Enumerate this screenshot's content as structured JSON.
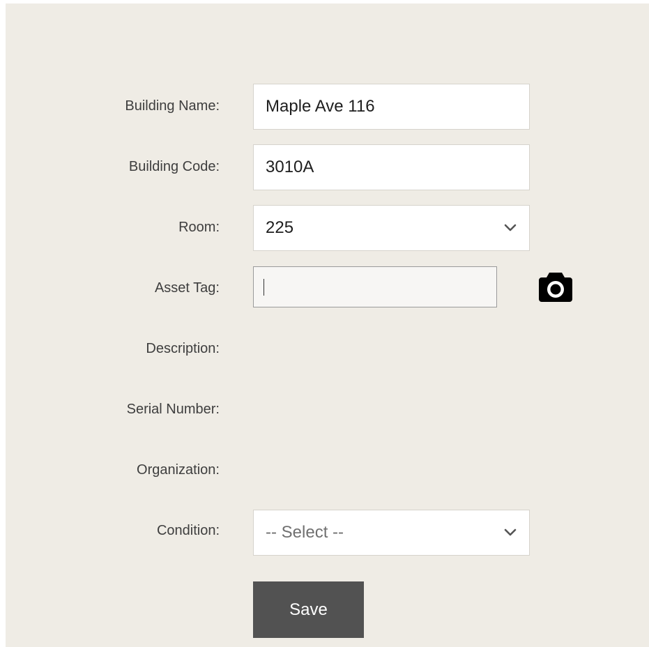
{
  "form": {
    "building_name": {
      "label": "Building Name:",
      "value": "Maple Ave 116"
    },
    "building_code": {
      "label": "Building Code:",
      "value": "3010A"
    },
    "room": {
      "label": "Room:",
      "value": "225"
    },
    "asset_tag": {
      "label": "Asset Tag:",
      "value": ""
    },
    "description": {
      "label": "Description:"
    },
    "serial_number": {
      "label": "Serial Number:"
    },
    "organization": {
      "label": "Organization:"
    },
    "condition": {
      "label": "Condition:",
      "value": "-- Select --"
    },
    "save_label": "Save"
  },
  "icons": {
    "camera": "camera-icon",
    "chevron": "chevron-down-icon"
  },
  "colors": {
    "background": "#efece5",
    "button": "#525252",
    "text": "#3e3e3e"
  }
}
